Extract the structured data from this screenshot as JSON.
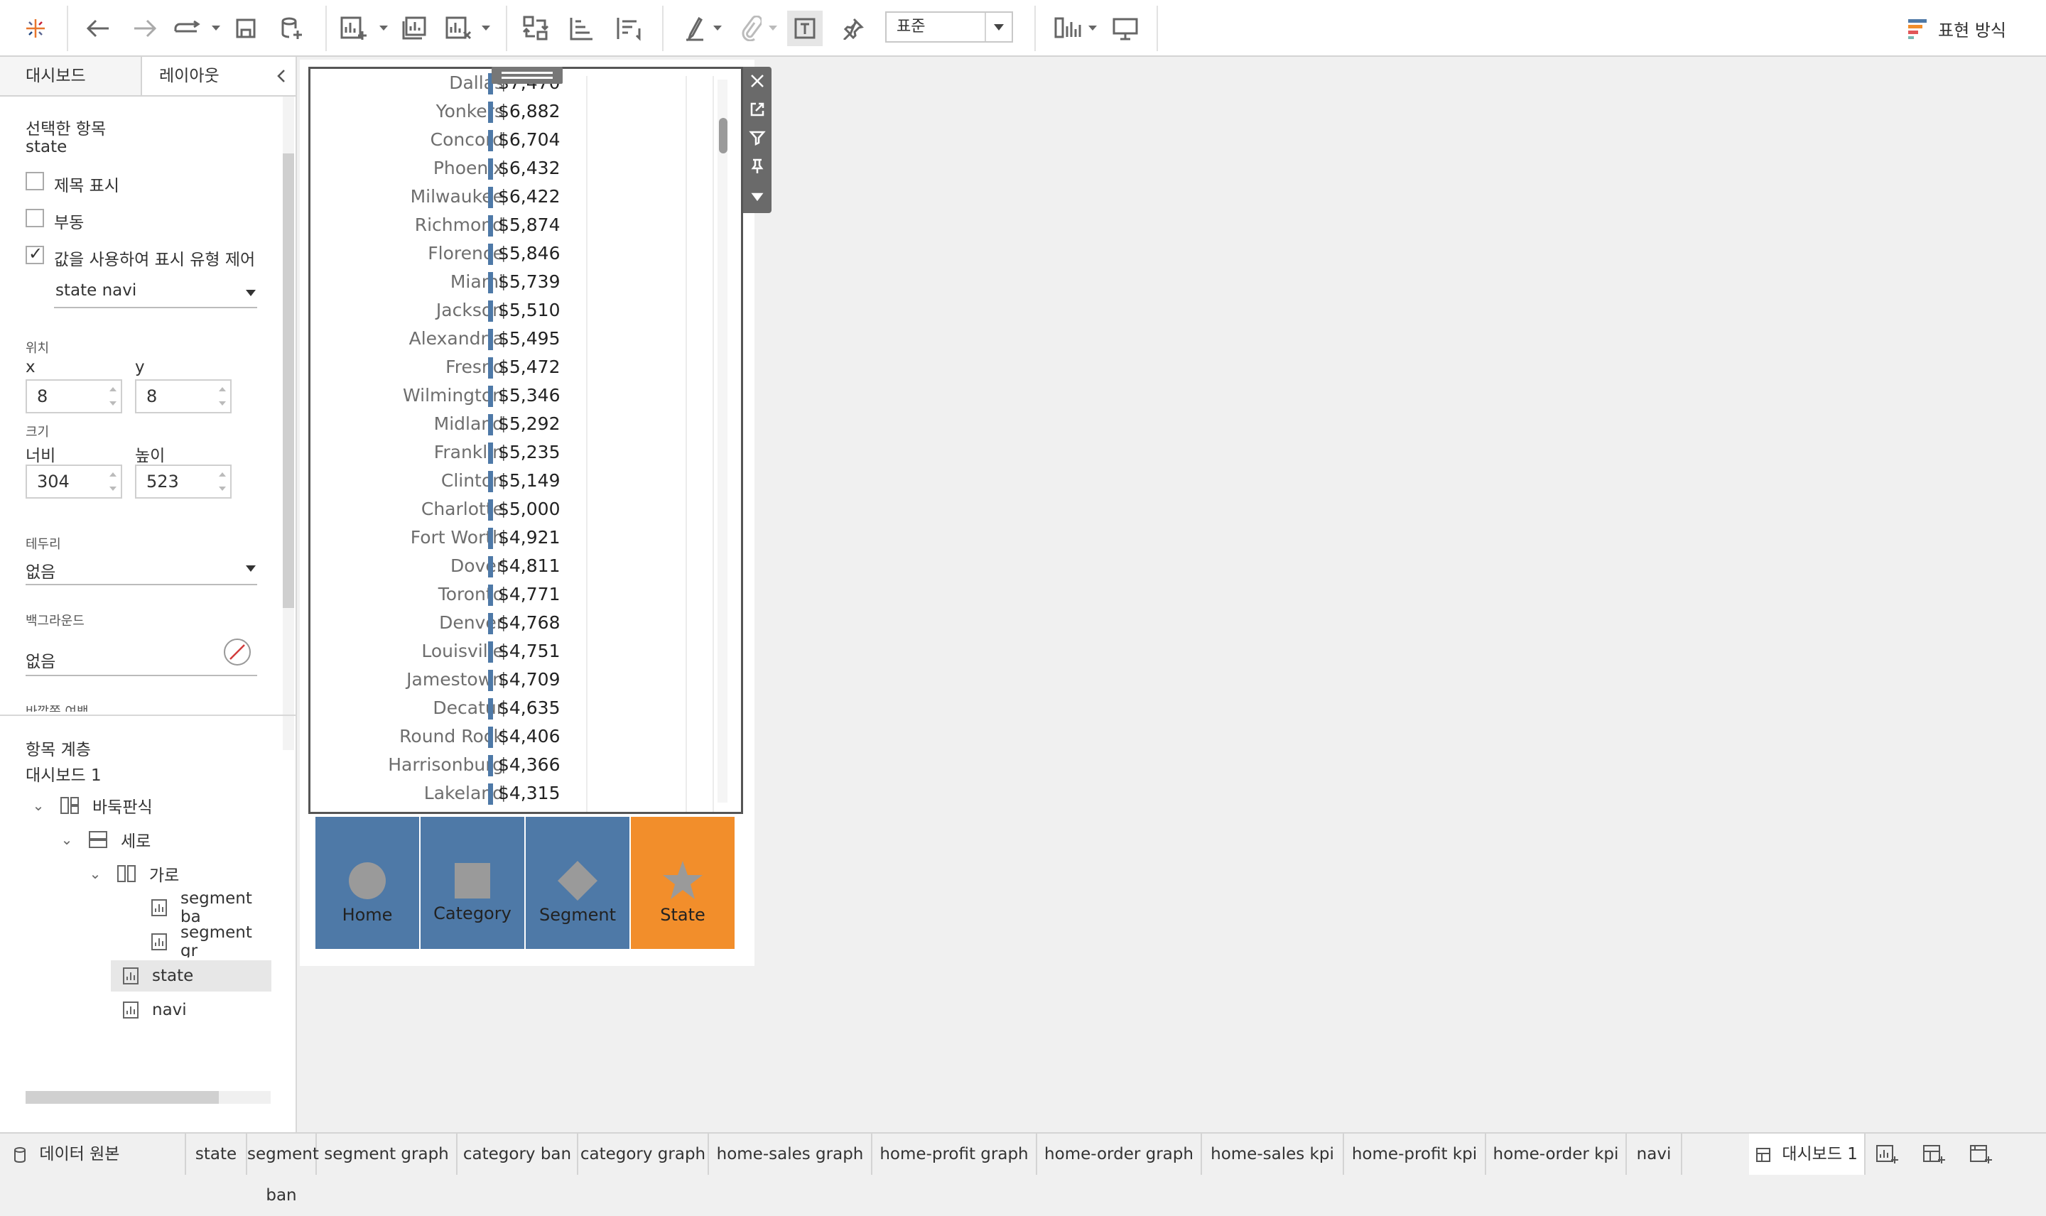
{
  "toolbar": {
    "fit_select": "표준",
    "show_me": "표현 방식",
    "icons": [
      "tableau-logo-icon",
      "undo-icon",
      "redo-icon",
      "replay-icon",
      "save-icon",
      "new-datasource-icon",
      "new-worksheet-icon",
      "duplicate-sheet-icon",
      "clear-sheet-icon",
      "swap-icon",
      "sort-ascending-icon",
      "sort-descending-icon",
      "highlight-icon",
      "group-icon",
      "show-labels-icon",
      "pin-icon",
      "fit-icon",
      "show-cards-icon",
      "presentation-icon"
    ]
  },
  "leftpanel": {
    "tabs": [
      "대시보드",
      "레이아웃"
    ],
    "selected_label": "선택한 항목",
    "selected_item": "state",
    "show_title": "제목 표시",
    "floating": "부동",
    "control_visibility": "값을 사용하여 표시 유형 제어",
    "visibility_field": "state navi",
    "position_label": "위치",
    "x_label": "x",
    "y_label": "y",
    "x_value": "8",
    "y_value": "8",
    "size_label": "크기",
    "width_label": "너비",
    "height_label": "높이",
    "width_value": "304",
    "height_value": "523",
    "border_label": "테두리",
    "border_value": "없음",
    "background_label": "백그라운드",
    "background_value": "없음",
    "outer_padding_label": "바깥쪽 여백",
    "hierarchy_label": "항목 계층",
    "hierarchy_root": "대시보드 1",
    "tree": [
      {
        "label": "바둑판식"
      },
      {
        "label": "세로"
      },
      {
        "label": "가로"
      },
      {
        "label": "segment ba"
      },
      {
        "label": "segment gr"
      },
      {
        "label": "state"
      },
      {
        "label": "navi"
      }
    ]
  },
  "state_sheet": {
    "rows": [
      {
        "city": "Dallas",
        "value": "$7,470"
      },
      {
        "city": "Yonkers",
        "value": "$6,882"
      },
      {
        "city": "Concord",
        "value": "$6,704"
      },
      {
        "city": "Phoenix",
        "value": "$6,432"
      },
      {
        "city": "Milwaukee",
        "value": "$6,422"
      },
      {
        "city": "Richmond",
        "value": "$5,874"
      },
      {
        "city": "Florence",
        "value": "$5,846"
      },
      {
        "city": "Miami",
        "value": "$5,739"
      },
      {
        "city": "Jackson",
        "value": "$5,510"
      },
      {
        "city": "Alexandria",
        "value": "$5,495"
      },
      {
        "city": "Fresno",
        "value": "$5,472"
      },
      {
        "city": "Wilmington",
        "value": "$5,346"
      },
      {
        "city": "Midland",
        "value": "$5,292"
      },
      {
        "city": "Franklin",
        "value": "$5,235"
      },
      {
        "city": "Clinton",
        "value": "$5,149"
      },
      {
        "city": "Charlotte",
        "value": "$5,000"
      },
      {
        "city": "Fort Worth",
        "value": "$4,921"
      },
      {
        "city": "Dover",
        "value": "$4,811"
      },
      {
        "city": "Toronto",
        "value": "$4,771"
      },
      {
        "city": "Denver",
        "value": "$4,768"
      },
      {
        "city": "Louisville",
        "value": "$4,751"
      },
      {
        "city": "Jamestown",
        "value": "$4,709"
      },
      {
        "city": "Decatur",
        "value": "$4,635"
      },
      {
        "city": "Round Rock",
        "value": "$4,406"
      },
      {
        "city": "Harrisonburg",
        "value": "$4,366"
      },
      {
        "city": "Lakeland",
        "value": "$4,315"
      }
    ],
    "bar_color": "#4e79a7",
    "tool_icons": [
      "close-icon",
      "open-sheet-icon",
      "filter-icon",
      "pin-icon",
      "more-options-icon"
    ]
  },
  "navi": {
    "buttons": [
      {
        "label": "Home",
        "shape": "circle"
      },
      {
        "label": "Category",
        "shape": "square"
      },
      {
        "label": "Segment",
        "shape": "diamond"
      },
      {
        "label": "State",
        "shape": "star"
      }
    ],
    "color": "#4e79a7",
    "active_color": "#f28e2b"
  },
  "bottom_tabs": {
    "datasource": "데이터 원본",
    "sheets": [
      "state",
      "segment ban",
      "segment graph",
      "category ban",
      "category graph",
      "home-sales graph",
      "home-profit graph",
      "home-order graph",
      "home-sales kpi",
      "home-profit kpi",
      "home-order kpi",
      "navi"
    ],
    "active": "대시보드 1",
    "action_icons": [
      "new-worksheet-icon",
      "new-dashboard-icon",
      "new-story-icon"
    ]
  }
}
